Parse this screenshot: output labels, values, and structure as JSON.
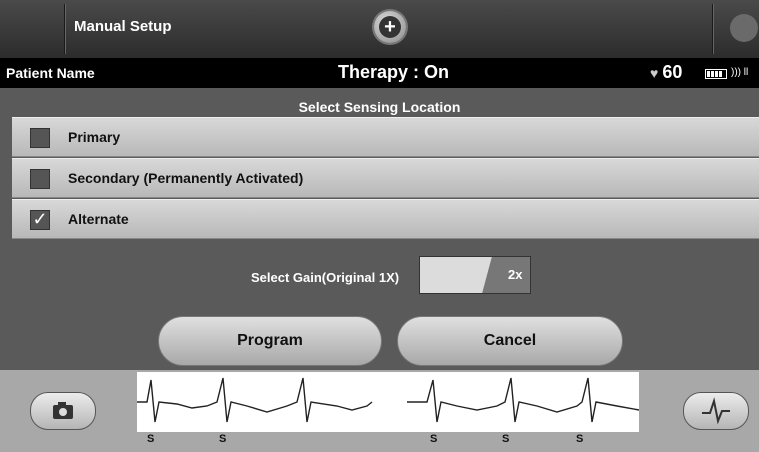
{
  "header": {
    "title": "Manual Setup",
    "add_icon": "plus-circle-icon",
    "wand_icon": "wand-icon"
  },
  "patient_bar": {
    "patient_name": "Patient Name",
    "therapy": "Therapy : On",
    "heart_rate": "60",
    "heart_icon": "heart-icon",
    "battery_icon": "battery-icon",
    "signal_icon": "signal-icon"
  },
  "sensing": {
    "title": "Select Sensing Location",
    "options": [
      {
        "label": "Primary",
        "checked": false
      },
      {
        "label": "Secondary (Permanently Activated)",
        "checked": false
      },
      {
        "label": "Alternate",
        "checked": true
      }
    ]
  },
  "gain": {
    "label": "Select Gain(Original 1X)",
    "value": "2x"
  },
  "buttons": {
    "program": "Program",
    "cancel": "Cancel"
  },
  "ecg": {
    "sense_markers": [
      "S",
      "S",
      "S",
      "S",
      "S"
    ],
    "camera_icon": "camera-icon",
    "ecg_icon": "ecg-icon"
  },
  "colors": {
    "background": "#5a5a5a",
    "status_bar": "#000000",
    "option_row": "#c8c8c8"
  }
}
